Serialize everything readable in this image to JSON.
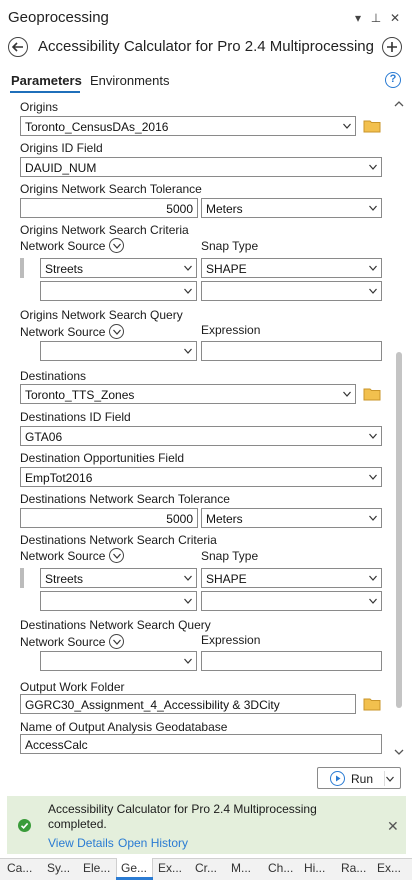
{
  "pane": {
    "title": "Geoprocessing",
    "ctrl_menu": "▾",
    "ctrl_pin": "⊥",
    "ctrl_close": "✕"
  },
  "tool": {
    "title": "Accessibility Calculator for Pro 2.4 Multiprocessing"
  },
  "tabs": {
    "parameters": "Parameters",
    "environments": "Environments"
  },
  "help": "?",
  "form": {
    "origins": {
      "label": "Origins",
      "value": "Toronto_CensusDAs_2016"
    },
    "origins_id": {
      "label": "Origins ID Field",
      "value": "DAUID_NUM"
    },
    "origins_tolerance": {
      "label": "Origins Network Search Tolerance",
      "value": "5000",
      "unit": "Meters"
    },
    "origins_criteria": {
      "label": "Origins Network Search Criteria",
      "col_source": "Network Source",
      "col_snap": "Snap Type",
      "row1_source": "Streets",
      "row1_snap": "SHAPE"
    },
    "origins_query": {
      "label": "Origins Network Search Query",
      "col_source": "Network Source",
      "col_expression": "Expression"
    },
    "destinations": {
      "label": "Destinations",
      "value": "Toronto_TTS_Zones"
    },
    "dest_id": {
      "label": "Destinations ID Field",
      "value": "GTA06"
    },
    "dest_opportunities": {
      "label": "Destination Opportunities Field",
      "value": "EmpTot2016"
    },
    "dest_tolerance": {
      "label": "Destinations Network Search Tolerance",
      "value": "5000",
      "unit": "Meters"
    },
    "dest_criteria": {
      "label": "Destinations Network Search Criteria",
      "col_source": "Network Source",
      "col_snap": "Snap Type",
      "row1_source": "Streets",
      "row1_snap": "SHAPE"
    },
    "dest_query": {
      "label": "Destinations Network Search Query",
      "col_source": "Network Source",
      "col_expression": "Expression"
    },
    "output_folder": {
      "label": "Output Work Folder",
      "value": "GGRC30_Assignment_4_Accessibility & 3DCity"
    },
    "output_gdb": {
      "label": "Name of Output Analysis Geodatabase",
      "value": "AccessCalc"
    }
  },
  "run": {
    "label": "Run"
  },
  "status": {
    "line1": "Accessibility Calculator for Pro 2.4 Multiprocessing",
    "line2": "completed.",
    "view_details": "View Details",
    "open_history": "Open History",
    "close": "✕"
  },
  "bottom_tabs": [
    "Ca...",
    "Sy...",
    "Ele...",
    "Ge...",
    "Ex...",
    "Cr...",
    "M...",
    "Ch...",
    "Hi...",
    "Ra...",
    "Ex..."
  ],
  "colors": {
    "accent": "#2a7bd3",
    "success_bg": "#e4efdc",
    "success_icon": "#3a9c3a"
  }
}
